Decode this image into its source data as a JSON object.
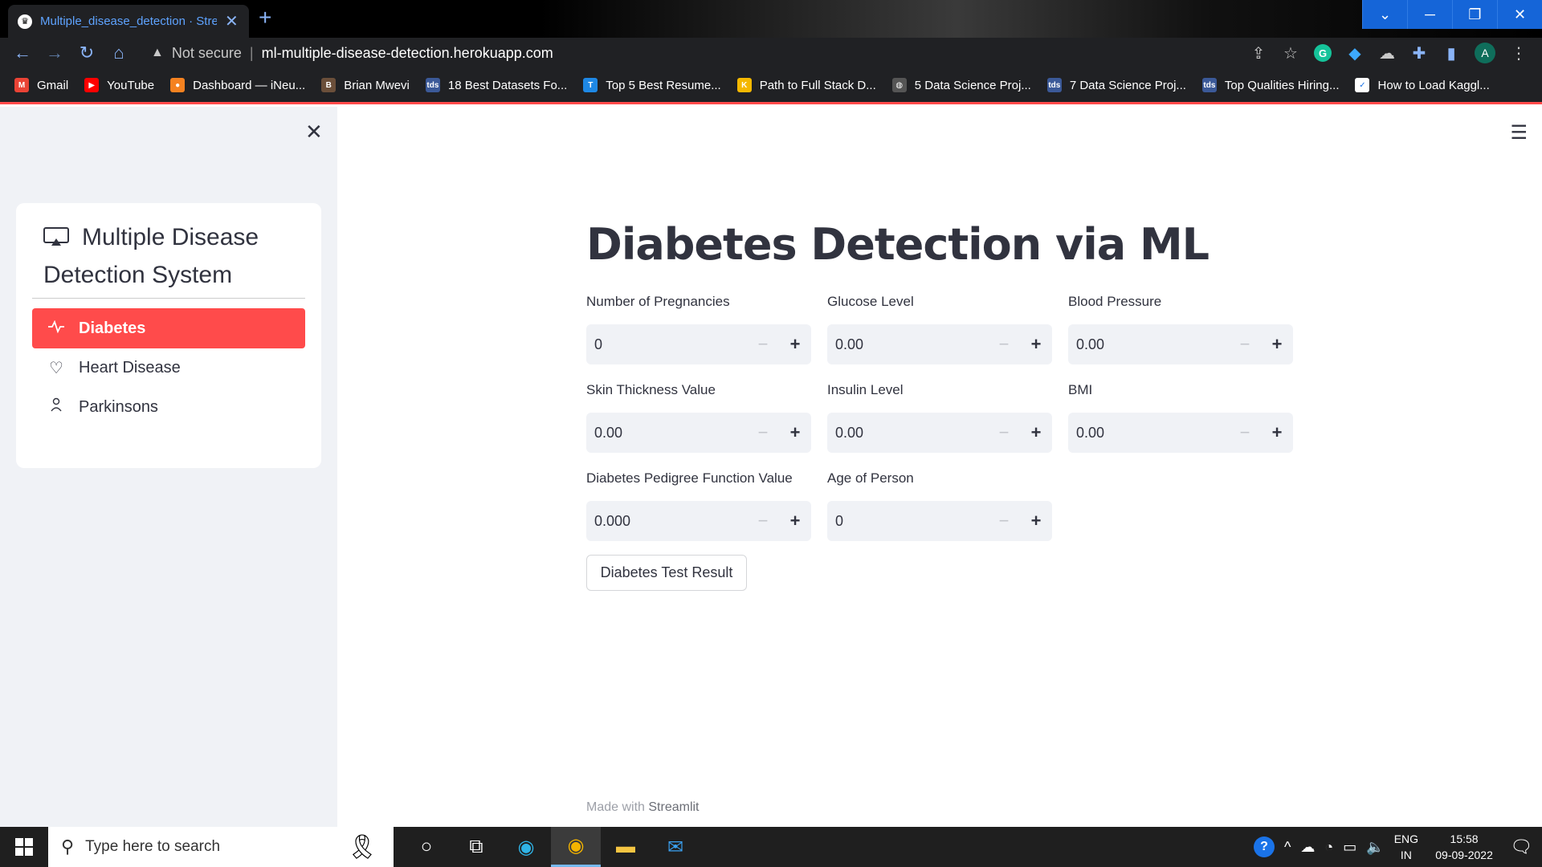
{
  "browser": {
    "tab_title": "Multiple_disease_detection · Stre",
    "security_label": "Not secure",
    "url": "ml-multiple-disease-detection.herokuapp.com",
    "profile_initial": "A",
    "bookmarks": [
      {
        "label": "Gmail",
        "icon": "gmail-icon",
        "color": "#ea4335",
        "glyph": "M"
      },
      {
        "label": "YouTube",
        "icon": "youtube-icon",
        "color": "#ff0000",
        "glyph": "▶"
      },
      {
        "label": "Dashboard — iNeu...",
        "icon": "ineuron-icon",
        "color": "#f58220",
        "glyph": "●"
      },
      {
        "label": "Brian Mwevi",
        "icon": "brian-icon",
        "color": "#6b4f3a",
        "glyph": "B"
      },
      {
        "label": "18 Best Datasets Fo...",
        "icon": "tds-icon",
        "color": "#3b5998",
        "glyph": "tds"
      },
      {
        "label": "Top 5 Best Resume...",
        "icon": "t-icon",
        "color": "#1e88e5",
        "glyph": "T"
      },
      {
        "label": "Path to Full Stack D...",
        "icon": "k-icon",
        "color": "#f5b800",
        "glyph": "K"
      },
      {
        "label": "5 Data Science Proj...",
        "icon": "globe-icon",
        "color": "#555555",
        "glyph": "◍"
      },
      {
        "label": "7 Data Science Proj...",
        "icon": "tds-icon",
        "color": "#3b5998",
        "glyph": "tds"
      },
      {
        "label": "Top Qualities Hiring...",
        "icon": "tds-icon",
        "color": "#3b5998",
        "glyph": "tds"
      },
      {
        "label": "How to Load Kaggl...",
        "icon": "page-icon",
        "color": "#ffffff",
        "glyph": "✓"
      }
    ]
  },
  "sidebar": {
    "title": "Multiple Disease Detection System",
    "items": [
      {
        "label": "Diabetes",
        "icon": "activity-icon",
        "active": true
      },
      {
        "label": "Heart Disease",
        "icon": "heart-icon",
        "active": false
      },
      {
        "label": "Parkinsons",
        "icon": "person-icon",
        "active": false
      }
    ]
  },
  "main": {
    "title": "Diabetes Detection via ML",
    "fields": [
      {
        "label": "Number of Pregnancies",
        "value": "0"
      },
      {
        "label": "Glucose Level",
        "value": "0.00"
      },
      {
        "label": "Blood Pressure",
        "value": "0.00"
      },
      {
        "label": "Skin Thickness Value",
        "value": "0.00"
      },
      {
        "label": "Insulin Level",
        "value": "0.00"
      },
      {
        "label": "BMI",
        "value": "0.00"
      },
      {
        "label": "Diabetes Pedigree Function Value",
        "value": "0.000"
      },
      {
        "label": "Age of Person",
        "value": "0"
      }
    ],
    "button_label": "Diabetes Test Result",
    "footer_prefix": "Made with",
    "footer_brand": "Streamlit"
  },
  "taskbar": {
    "search_placeholder": "Type here to search",
    "lang_top": "ENG",
    "lang_bottom": "IN",
    "time": "15:58",
    "date": "09-09-2022"
  },
  "colors": {
    "accent": "#ff4b4b",
    "sidebar_bg": "#f0f2f6",
    "text": "#31333f"
  }
}
